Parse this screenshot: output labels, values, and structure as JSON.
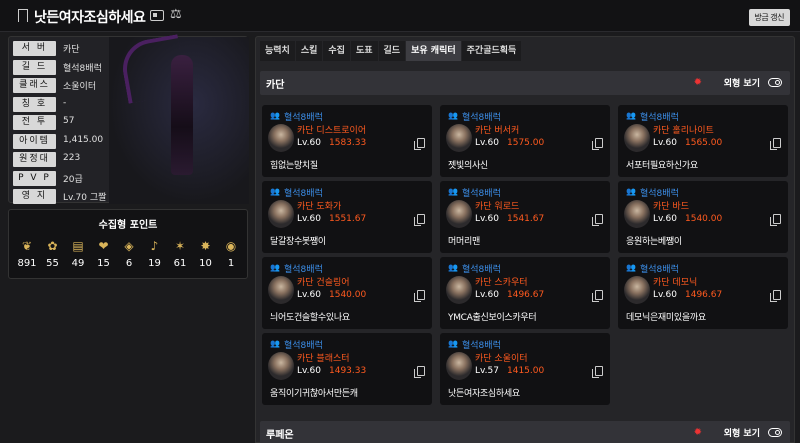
{
  "header": {
    "title": "낫든여자조심하세요",
    "refresh_label": "방금 갱신",
    "icons": [
      "bookmark-icon",
      "id-card-icon",
      "scale-icon"
    ]
  },
  "profile": {
    "rows": [
      {
        "label": "서 버",
        "value": "카단"
      },
      {
        "label": "길 드",
        "value": "혈석8배럭"
      },
      {
        "label": "클래스",
        "value": "소울이터"
      },
      {
        "label": "칭 호",
        "value": "-"
      },
      {
        "label": "전 투",
        "value": "57"
      },
      {
        "label": "아이템",
        "value": "1,415.00"
      },
      {
        "label": "원정대",
        "value": "223"
      },
      {
        "label": "P V P",
        "value": "20급"
      },
      {
        "label": "영 지",
        "value": "Lv.70 그짤"
      }
    ]
  },
  "collection": {
    "title": "수집형 포인트",
    "items": [
      {
        "icon": "island-heart-icon",
        "count": "891"
      },
      {
        "icon": "seed-icon",
        "count": "55"
      },
      {
        "icon": "map-icon",
        "count": "49"
      },
      {
        "icon": "heart-icon",
        "count": "15"
      },
      {
        "icon": "relic-icon",
        "count": "6"
      },
      {
        "icon": "instrument-icon",
        "count": "19"
      },
      {
        "icon": "star-icon",
        "count": "61"
      },
      {
        "icon": "compass-icon",
        "count": "10"
      },
      {
        "icon": "medal-icon",
        "count": "1"
      }
    ]
  },
  "tabs": [
    "능력치",
    "스킬",
    "수집",
    "도표",
    "길드",
    "보유 캐릭터",
    "주간골드획득"
  ],
  "active_tab": "보유 캐릭터",
  "sections": [
    {
      "name": "카단",
      "view_label": "외형 보기"
    },
    {
      "name": "루페온",
      "view_label": "외형 보기"
    }
  ],
  "characters": [
    {
      "guild": "혈석8배럭",
      "server_class": "카단  디스트로이어",
      "level": "Lv.60",
      "item_level": "1583.33",
      "name": "힘없는망치질"
    },
    {
      "guild": "혈석8배럭",
      "server_class": "카단  버서커",
      "level": "Lv.60",
      "item_level": "1575.00",
      "name": "젯빛의사신"
    },
    {
      "guild": "혈석8배럭",
      "server_class": "카단  홀리나이트",
      "level": "Lv.60",
      "item_level": "1565.00",
      "name": "서포터필요하신가요"
    },
    {
      "guild": "혈석8배럭",
      "server_class": "카단  도화가",
      "level": "Lv.60",
      "item_level": "1551.67",
      "name": "달갈장수봇쨍이"
    },
    {
      "guild": "혈석8배럭",
      "server_class": "카단  워로드",
      "level": "Lv.60",
      "item_level": "1541.67",
      "name": "머머리맨"
    },
    {
      "guild": "혈석8배럭",
      "server_class": "카단  바드",
      "level": "Lv.60",
      "item_level": "1540.00",
      "name": "응원하는베쨍이"
    },
    {
      "guild": "혈석8배럭",
      "server_class": "카단  건슬링어",
      "level": "Lv.60",
      "item_level": "1540.00",
      "name": "늬어도건슬할수있나요"
    },
    {
      "guild": "혈석8배럭",
      "server_class": "카단  스카우터",
      "level": "Lv.60",
      "item_level": "1496.67",
      "name": "YMCA출신보이스카우터"
    },
    {
      "guild": "혈석8배럭",
      "server_class": "카단  데모닉",
      "level": "Lv.60",
      "item_level": "1496.67",
      "name": "데모닉은재미있을까요"
    },
    {
      "guild": "혈석8배럭",
      "server_class": "카단  블래스터",
      "level": "Lv.60",
      "item_level": "1493.33",
      "name": "움직이기귀찮아서만든캐"
    },
    {
      "guild": "혈석8배럭",
      "server_class": "카단  소울이터",
      "level": "Lv.57",
      "item_level": "1415.00",
      "name": "낫든여자조심하세요"
    }
  ],
  "colors": {
    "accent_orange": "#ff5a1f",
    "guild_blue": "#3c8ee8",
    "alert_red": "#e33"
  }
}
